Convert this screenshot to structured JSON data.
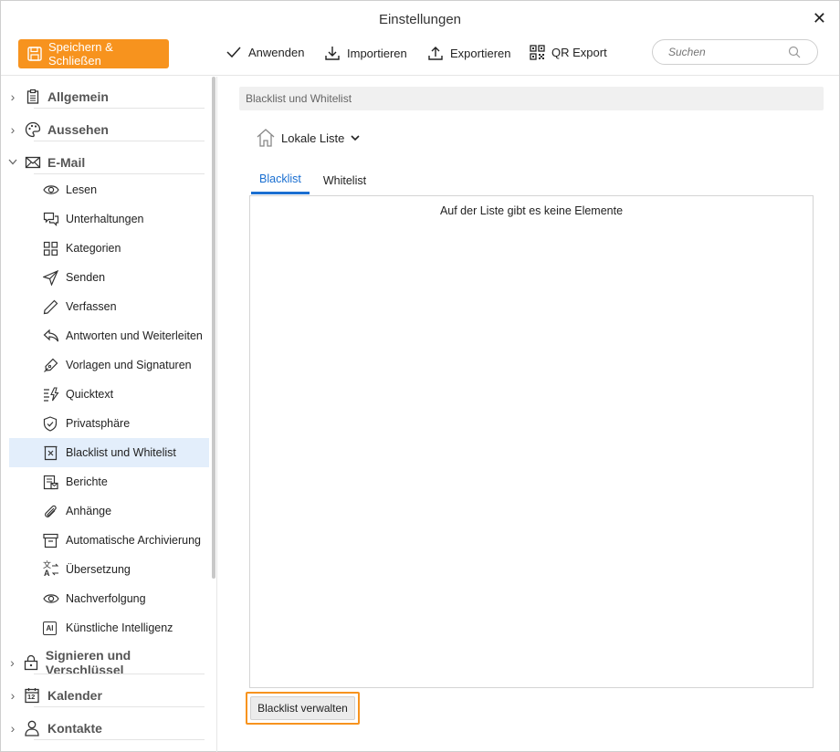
{
  "window": {
    "title": "Einstellungen"
  },
  "toolbar": {
    "save_label": "Speichern & Schließen",
    "apply_label": "Anwenden",
    "import_label": "Importieren",
    "export_label": "Exportieren",
    "qr_label": "QR Export",
    "search_placeholder": "Suchen"
  },
  "colors": {
    "accent": "#f7931e",
    "tab_active": "#1a6fd1",
    "selected_bg": "#e3eefb"
  },
  "sidebar": {
    "categories": [
      {
        "label": "Allgemein",
        "icon": "clipboard-icon",
        "expanded": false
      },
      {
        "label": "Aussehen",
        "icon": "palette-icon",
        "expanded": false
      },
      {
        "label": "E-Mail",
        "icon": "mail-icon",
        "expanded": true
      },
      {
        "label": "Signieren und Verschlüssel",
        "icon": "lock-icon",
        "expanded": false
      },
      {
        "label": "Kalender",
        "icon": "calendar-icon",
        "expanded": false
      },
      {
        "label": "Kontakte",
        "icon": "person-icon",
        "expanded": false
      }
    ],
    "calendar_day": "12",
    "ai_badge": "AI",
    "translate_top": "文",
    "translate_bottom": "A",
    "email_items": [
      {
        "label": "Lesen",
        "icon": "eye-icon"
      },
      {
        "label": "Unterhaltungen",
        "icon": "chat-icon"
      },
      {
        "label": "Kategorien",
        "icon": "grid-icon"
      },
      {
        "label": "Senden",
        "icon": "send-icon"
      },
      {
        "label": "Verfassen",
        "icon": "pencil-icon"
      },
      {
        "label": "Antworten und Weiterleiten",
        "icon": "reply-icon"
      },
      {
        "label": "Vorlagen und Signaturen",
        "icon": "pen-nib-icon"
      },
      {
        "label": "Quicktext",
        "icon": "quicktext-icon"
      },
      {
        "label": "Privatsphäre",
        "icon": "shield-icon"
      },
      {
        "label": "Blacklist und Whitelist",
        "icon": "blacklist-icon",
        "selected": true
      },
      {
        "label": "Berichte",
        "icon": "report-icon"
      },
      {
        "label": "Anhänge",
        "icon": "paperclip-icon"
      },
      {
        "label": "Automatische Archivierung",
        "icon": "archive-icon"
      },
      {
        "label": "Übersetzung",
        "icon": "translate-icon"
      },
      {
        "label": "Nachverfolgung",
        "icon": "eye-icon"
      },
      {
        "label": "Künstliche Intelligenz",
        "icon": "ai-icon"
      }
    ]
  },
  "main": {
    "header": "Blacklist und Whitelist",
    "list_selector": "Lokale Liste",
    "tabs": [
      {
        "label": "Blacklist",
        "active": true
      },
      {
        "label": "Whitelist",
        "active": false
      }
    ],
    "empty_message": "Auf der Liste gibt es keine Elemente",
    "manage_button": "Blacklist verwalten"
  }
}
